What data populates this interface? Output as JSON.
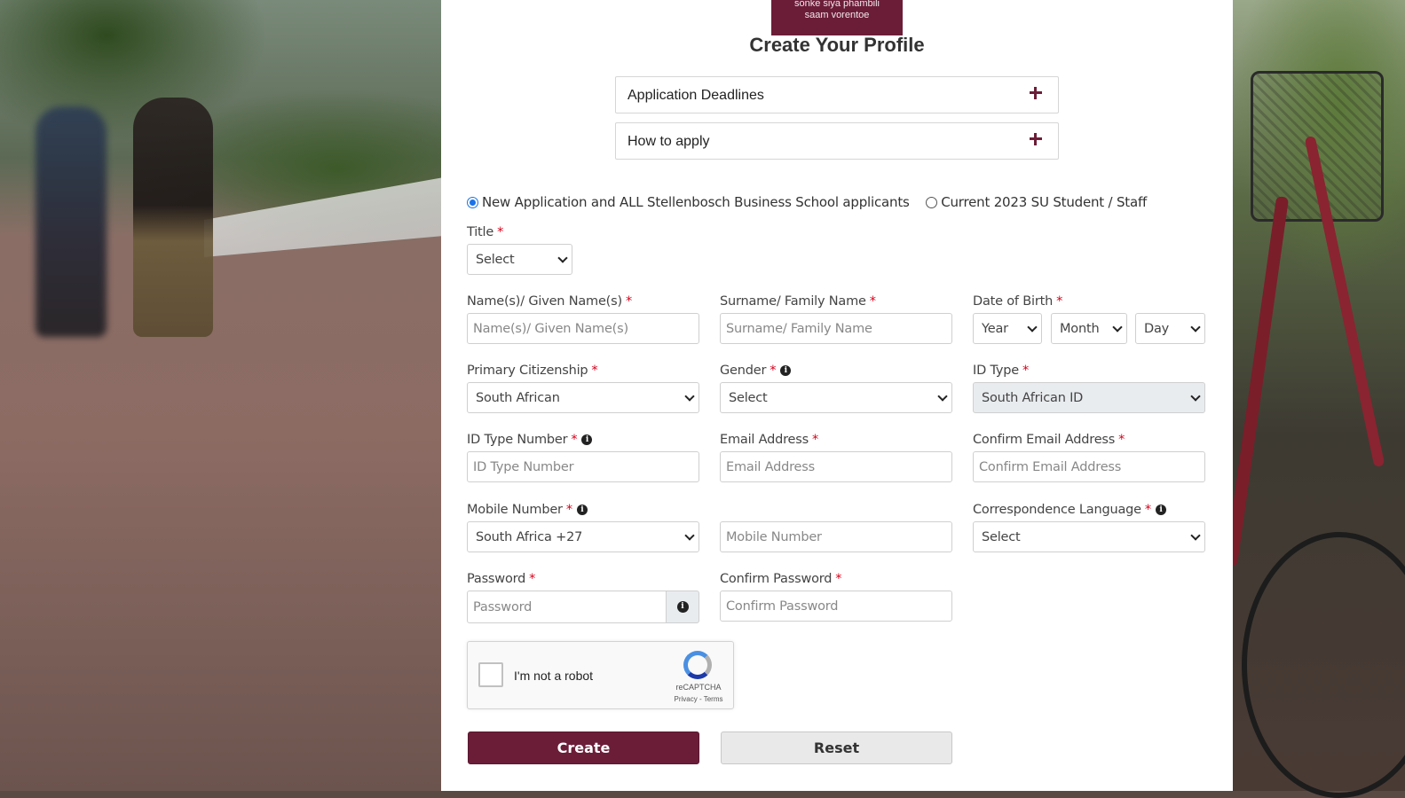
{
  "logo": {
    "line1": "sonke siya phambili",
    "line2": "saam vorentoe"
  },
  "page_title": "Create Your Profile",
  "accordions": [
    {
      "label": "Application Deadlines",
      "icon": "plus-icon"
    },
    {
      "label": "How to apply",
      "icon": "plus-icon"
    }
  ],
  "application_type": {
    "options": [
      {
        "label": "New Application and ALL Stellenbosch Business School applicants",
        "checked": true
      },
      {
        "label": "Current 2023 SU Student / Staff",
        "checked": false
      }
    ]
  },
  "form": {
    "title": {
      "label": "Title",
      "value": "Select"
    },
    "given_name": {
      "label": "Name(s)/ Given Name(s)",
      "placeholder": "Name(s)/ Given Name(s)"
    },
    "surname": {
      "label": "Surname/ Family Name",
      "placeholder": "Surname/ Family Name"
    },
    "dob": {
      "label": "Date of Birth",
      "year": "Year",
      "month": "Month",
      "day": "Day"
    },
    "citizenship": {
      "label": "Primary Citizenship",
      "value": "South African"
    },
    "gender": {
      "label": "Gender",
      "value": "Select"
    },
    "id_type": {
      "label": "ID Type",
      "value": "South African ID"
    },
    "id_number": {
      "label": "ID Type Number",
      "placeholder": "ID Type Number"
    },
    "email": {
      "label": "Email Address",
      "placeholder": "Email Address"
    },
    "confirm_email": {
      "label": "Confirm Email Address",
      "placeholder": "Confirm Email Address"
    },
    "mobile": {
      "label": "Mobile Number",
      "country": "South Africa +27",
      "placeholder": "Mobile Number"
    },
    "language": {
      "label": "Correspondence Language",
      "value": "Select"
    },
    "password": {
      "label": "Password",
      "placeholder": "Password"
    },
    "confirm_password": {
      "label": "Confirm Password",
      "placeholder": "Confirm Password"
    },
    "required_mark": "*"
  },
  "captcha": {
    "text": "I'm not a robot",
    "brand": "reCAPTCHA",
    "terms": "Privacy - Terms"
  },
  "buttons": {
    "create": "Create",
    "reset": "Reset"
  },
  "colors": {
    "brand": "#6b1d38",
    "required": "#d9001b",
    "radio_selected": "#1a73e8"
  }
}
